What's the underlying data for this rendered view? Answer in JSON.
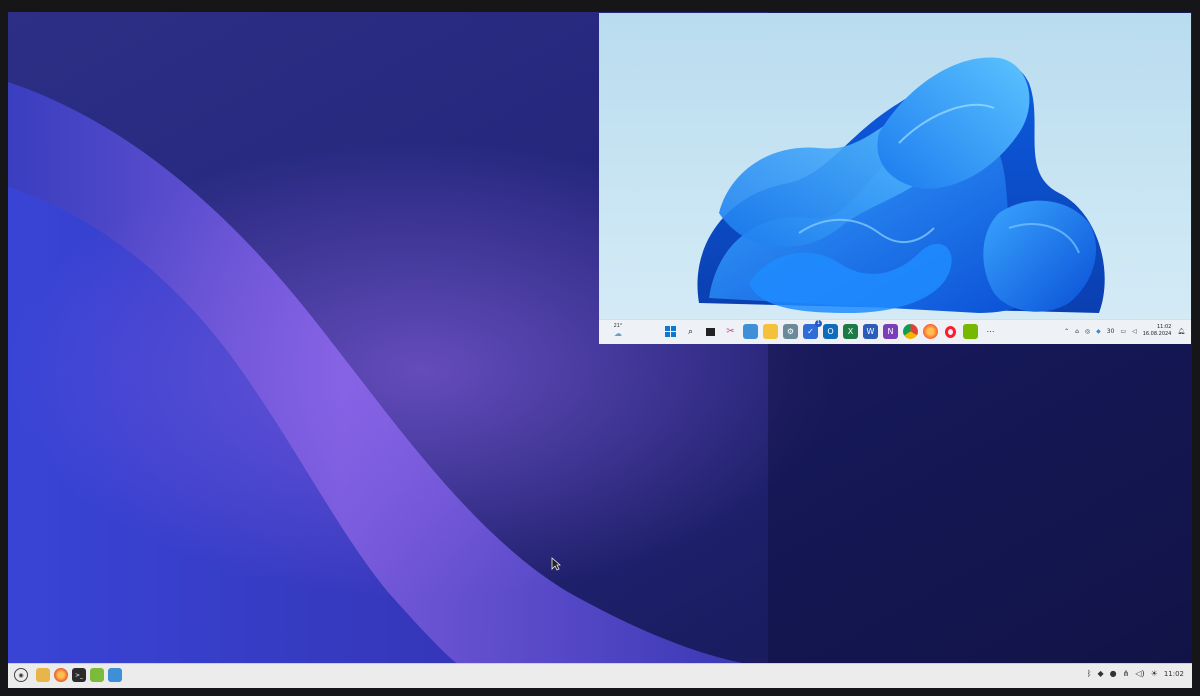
{
  "windows_preview": {
    "weather_temp": "21°",
    "taskbar_apps": [
      "start",
      "search",
      "task-view",
      "snipping",
      "notepad",
      "file-explorer",
      "settings",
      "to-do",
      "outlook",
      "excel",
      "word",
      "onenote",
      "chrome",
      "firefox",
      "opera",
      "nvidia",
      "more"
    ],
    "todo_badge": "1",
    "tray_language": "30",
    "clock_time": "11:02",
    "clock_date": "16.08.2024"
  },
  "linux_panel": {
    "launchers": [
      "files",
      "firefox",
      "terminal",
      "software-manager",
      "text-editor"
    ],
    "clock_time": "11:02"
  }
}
